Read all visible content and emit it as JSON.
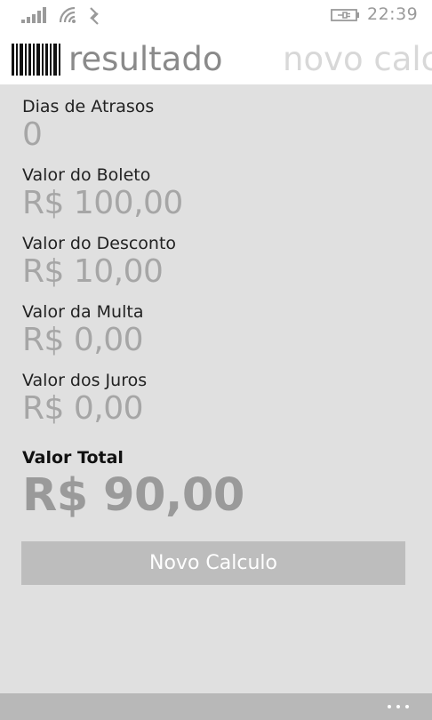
{
  "status_bar": {
    "time": "22:39",
    "icons": [
      "signal-strength-icon",
      "wifi-icon",
      "data-connection-icon",
      "battery-charging-icon"
    ]
  },
  "pivot": {
    "active_title": "resultado",
    "next_title": "novo calculo",
    "logo_icon": "barcode-icon"
  },
  "results": {
    "dias_atraso": {
      "label": "Dias de Atrasos",
      "value": "0"
    },
    "valor_boleto": {
      "label": "Valor do Boleto",
      "value": "R$ 100,00"
    },
    "valor_desconto": {
      "label": "Valor do Desconto",
      "value": "R$ 10,00"
    },
    "valor_multa": {
      "label": "Valor da Multa",
      "value": "R$ 0,00"
    },
    "valor_juros": {
      "label": "Valor dos Juros",
      "value": "R$ 0,00"
    },
    "valor_total": {
      "label": "Valor Total",
      "value": "R$ 90,00"
    }
  },
  "actions": {
    "novo_calculo_label": "Novo Calculo"
  },
  "app_bar": {
    "more_icon": "ellipsis-icon"
  },
  "colors": {
    "background": "#e0e0e0",
    "header_background": "#ffffff",
    "button_background": "#bdbdbd",
    "app_bar_background": "#b8b8b8",
    "value_text": "#a6a6a6"
  }
}
